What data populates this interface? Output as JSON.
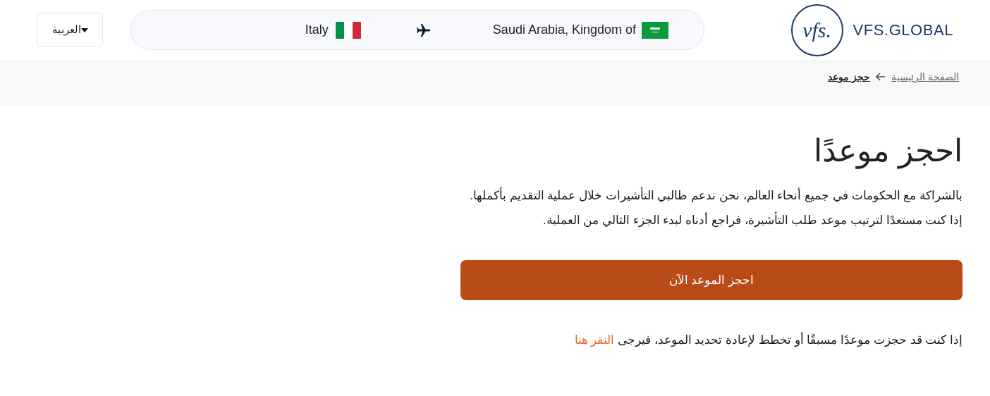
{
  "header": {
    "language": {
      "label": "العربية"
    },
    "route": {
      "origin": "Saudi Arabia, Kingdom of",
      "destination": "Italy"
    },
    "logo": {
      "mark": "vfs.",
      "name": "VFS.GLOBAL"
    }
  },
  "breadcrumb": [
    {
      "label": "الصفحة الرئيسية",
      "current": false
    },
    {
      "label": "حجز موعد",
      "current": true
    }
  ],
  "title": "احجز موعدًا",
  "paragraphs": [
    "بالشراكة مع الحكومات في جميع أنحاء العالم، نحن ندعم طالبي التأشيرات خلال عملية التقديم بأكملها.",
    "إذا كنت مستعدًا لترتيب موعد طلب التأشيرة، فراجع أدناه لبدء الجزء التالي من العملية."
  ],
  "book_button": "احجز الموعد الآن",
  "rebook": {
    "text": "إذا كنت قد حجزت موعدًا مسبقًا أو تخطط لإعادة تحديد الموعد، فيرجى",
    "link": "النقر هنا"
  }
}
